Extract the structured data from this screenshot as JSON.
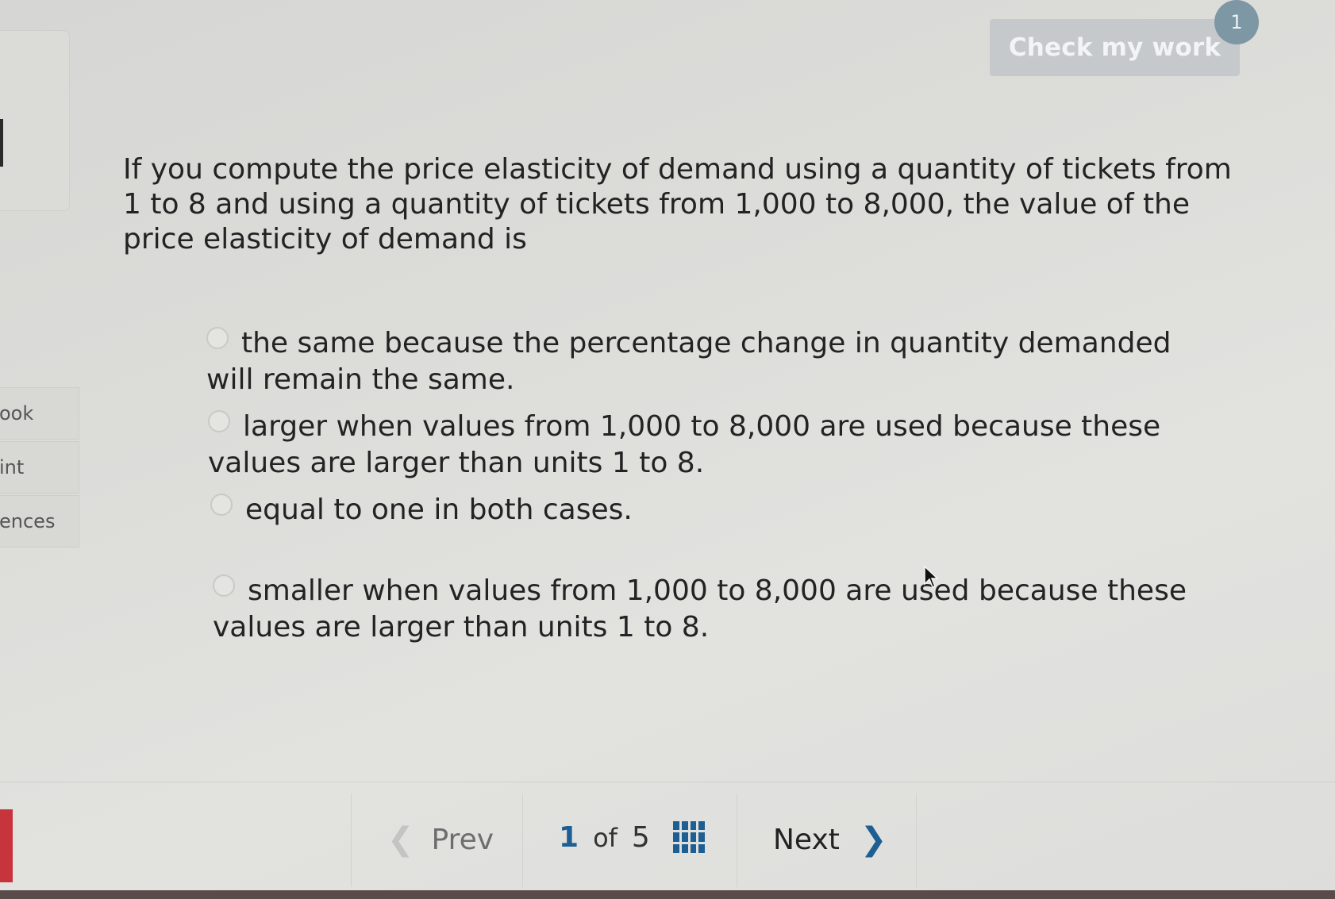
{
  "header": {
    "check_label": "Check my work",
    "check_badge": "1"
  },
  "sidebar": {
    "items": [
      {
        "label": "ook"
      },
      {
        "label": "int"
      },
      {
        "label": "ences"
      }
    ]
  },
  "question": {
    "text": "If you compute the price elasticity of demand using a quantity of tickets from 1 to 8 and using a quantity of tickets from 1,000 to 8,000, the value of the price elasticity of demand is"
  },
  "options": [
    {
      "label": "the same because the percentage change in quantity demanded will remain the same.",
      "selected": false
    },
    {
      "label": "larger when values from 1,000 to 8,000 are used because these values are larger than units 1 to 8.",
      "selected": false
    },
    {
      "label": "equal to one in both cases.",
      "selected": false
    },
    {
      "label": "smaller when values from 1,000 to 8,000 are used because these values are larger than units 1 to 8.",
      "selected": false
    }
  ],
  "nav": {
    "prev_label": "Prev",
    "current_page": "1",
    "of_label": "of",
    "total_pages": "5",
    "next_label": "Next"
  },
  "colors": {
    "accent": "#1d5f93",
    "badge": "#7d97a5",
    "check_button": "#c5c9cc"
  },
  "icons": [
    "chevron-left-icon",
    "grid-icon",
    "chevron-right-icon",
    "radio-icon"
  ]
}
